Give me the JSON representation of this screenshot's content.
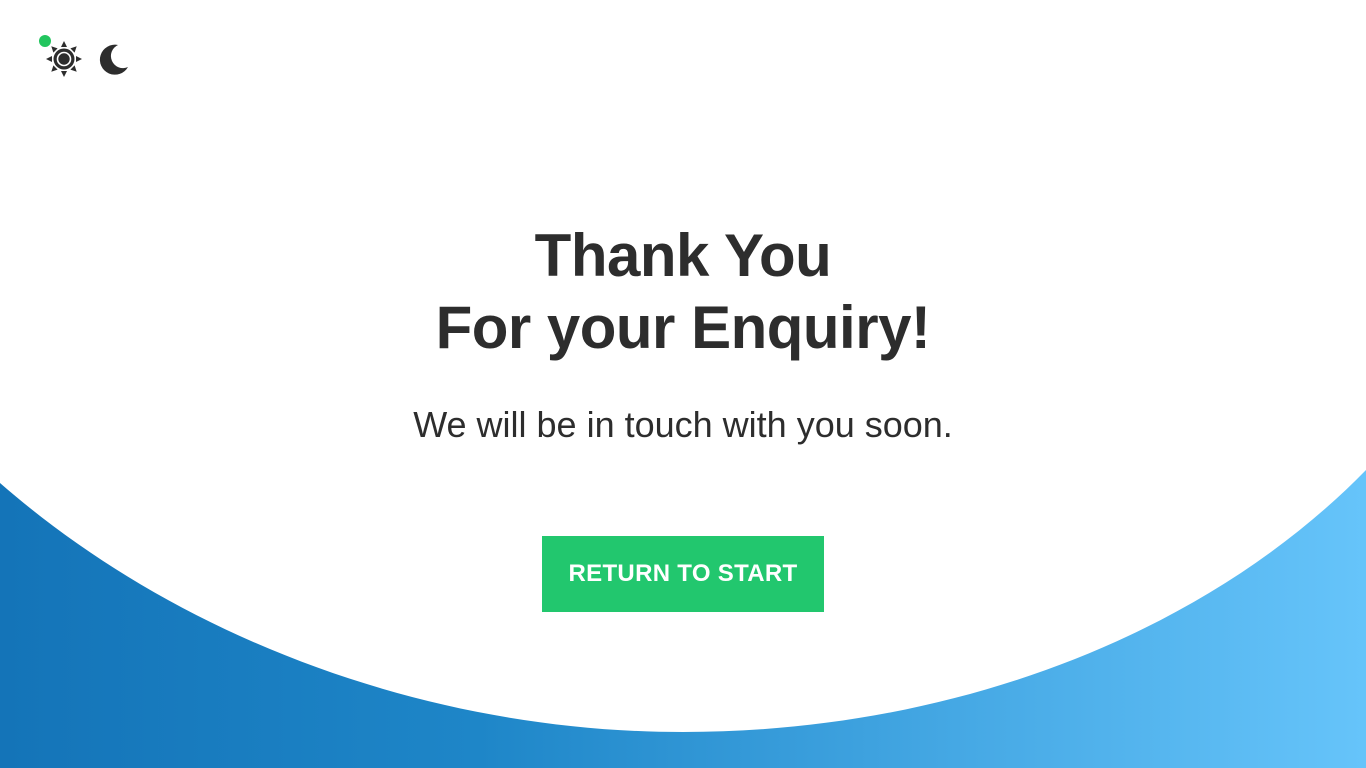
{
  "header": {
    "status_dot_color": "#22c55e",
    "icons": [
      "sun-icon",
      "moon-icon"
    ]
  },
  "main": {
    "headline_line1": "Thank You",
    "headline_line2": "For your Enquiry!",
    "subtitle": "We will be in touch with you soon.",
    "cta_label": "RETURN TO START"
  },
  "colors": {
    "text": "#2d2d2d",
    "button": "#22c76e",
    "wave_left": "#1474b8",
    "wave_right": "#66c4fa"
  }
}
